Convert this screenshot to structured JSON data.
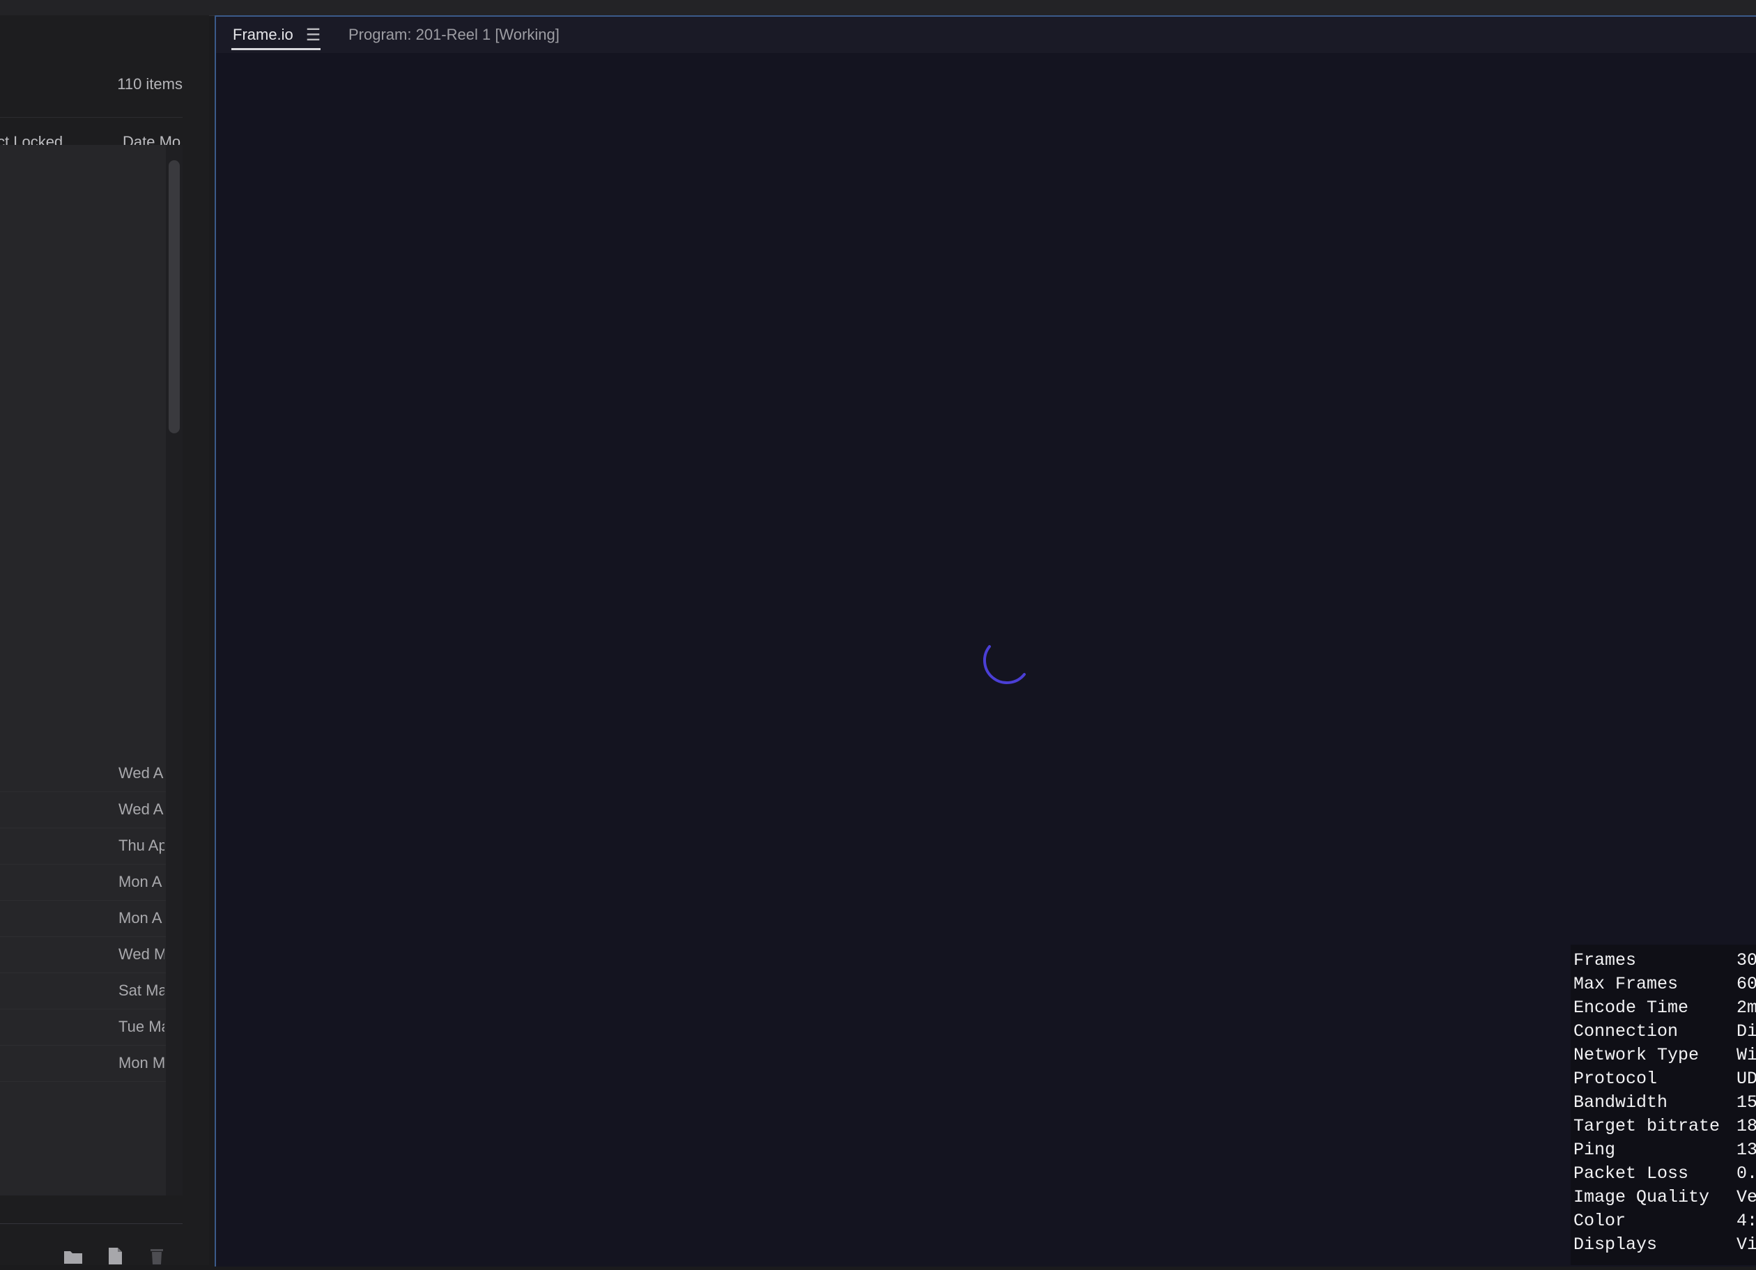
{
  "project_panel": {
    "items_count": "110 items",
    "columns": {
      "locked": "ct Locked",
      "date": "Date Mo"
    },
    "rows": [
      "Wed A",
      "Wed A",
      "Thu Ap",
      "Mon A",
      "Mon A",
      "Wed M",
      "Sat Ma",
      "Tue Ma",
      "Mon M"
    ]
  },
  "viewer": {
    "tab_active": "Frame.io",
    "tab_menu": "☰",
    "tab_program": "Program: 201-Reel 1 [Working]"
  },
  "stats": [
    {
      "k": "Frames",
      "v": "30"
    },
    {
      "k": "Max Frames",
      "v": "60"
    },
    {
      "k": "Encode Time",
      "v": "2m"
    },
    {
      "k": "Connection",
      "v": "Di"
    },
    {
      "k": "Network Type",
      "v": "Wi"
    },
    {
      "k": "Protocol",
      "v": "UD"
    },
    {
      "k": "Bandwidth",
      "v": "15"
    },
    {
      "k": "Target bitrate",
      "v": "18"
    },
    {
      "k": "Ping",
      "v": "13"
    },
    {
      "k": "Packet Loss",
      "v": "0."
    },
    {
      "k": "Image Quality",
      "v": "Ve"
    },
    {
      "k": "Color",
      "v": "4:"
    },
    {
      "k": "Displays",
      "v": "Vi"
    }
  ]
}
